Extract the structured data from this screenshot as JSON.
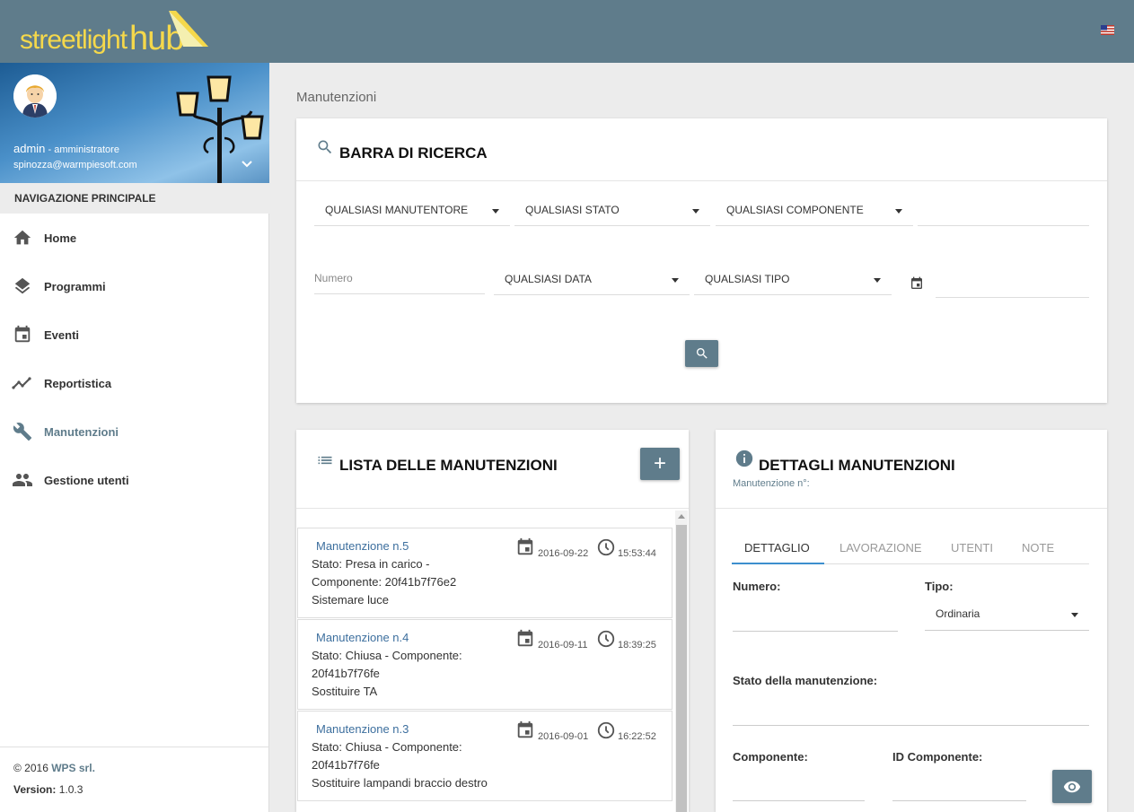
{
  "header": {
    "logo_part1": "streetlight",
    "logo_part2": "hub",
    "language_flag": "us-flag-icon"
  },
  "profile": {
    "username": "admin",
    "role": " - amministratore",
    "email": "spinozza@warmpiesoft.com"
  },
  "nav": {
    "heading": "NAVIGAZIONE PRINCIPALE",
    "items": [
      {
        "label": "Home",
        "icon": "home-icon"
      },
      {
        "label": "Programmi",
        "icon": "layers-icon"
      },
      {
        "label": "Eventi",
        "icon": "calendar-icon"
      },
      {
        "label": "Reportistica",
        "icon": "trending-icon"
      },
      {
        "label": "Manutenzioni",
        "icon": "wrench-icon",
        "active": true
      },
      {
        "label": "Gestione utenti",
        "icon": "people-icon"
      }
    ]
  },
  "footer": {
    "copyright": "© 2016 ",
    "company": "WPS srl.",
    "version_label": "Version:",
    "version": " 1.0.3"
  },
  "breadcrumb": "Manutenzioni",
  "search": {
    "title": "BARRA DI RICERCA",
    "manutentore": "QUALSIASI MANUTENTORE",
    "stato": "QUALSIASI STATO",
    "componente": "QUALSIASI COMPONENTE",
    "numero_placeholder": "Numero",
    "data": "QUALSIASI DATA",
    "tipo": "QUALSIASI TIPO"
  },
  "list": {
    "title": "LISTA DELLE MANUTENZIONI",
    "add_label": "+",
    "items": [
      {
        "title": "Manutenzione n.5",
        "line1": "Stato: Presa in carico -",
        "line2": "Componente: 20f41b7f76e2",
        "line3": "Sistemare luce",
        "date": "2016-09-22",
        "time": "15:53:44"
      },
      {
        "title": "Manutenzione n.4",
        "line1": "Stato: Chiusa - Componente:",
        "line2": "20f41b7f76fe",
        "line3": "Sostituire TA",
        "date": "2016-09-11",
        "time": "18:39:25"
      },
      {
        "title": "Manutenzione n.3",
        "line1": "Stato: Chiusa - Componente:",
        "line2": "20f41b7f76fe",
        "line3": "Sostituire lampandi braccio destro",
        "date": "2016-09-01",
        "time": "16:22:52"
      }
    ]
  },
  "details": {
    "title": "DETTAGLI MANUTENZIONI",
    "subtitle": "Manutenzione n°:",
    "tabs": [
      "DETTAGLIO",
      "LAVORAZIONE",
      "UTENTI",
      "NOTE"
    ],
    "numero_label": "Numero:",
    "tipo_label": "Tipo:",
    "tipo_value": "Ordinaria",
    "stato_label": "Stato della manutenzione:",
    "componente_label": "Componente:",
    "id_componente_label": "ID Componente:"
  },
  "colors": {
    "header": "#5f7c8b",
    "accent": "#3d8fce",
    "logo": "#f5d84b",
    "link": "#3d6f9e"
  }
}
